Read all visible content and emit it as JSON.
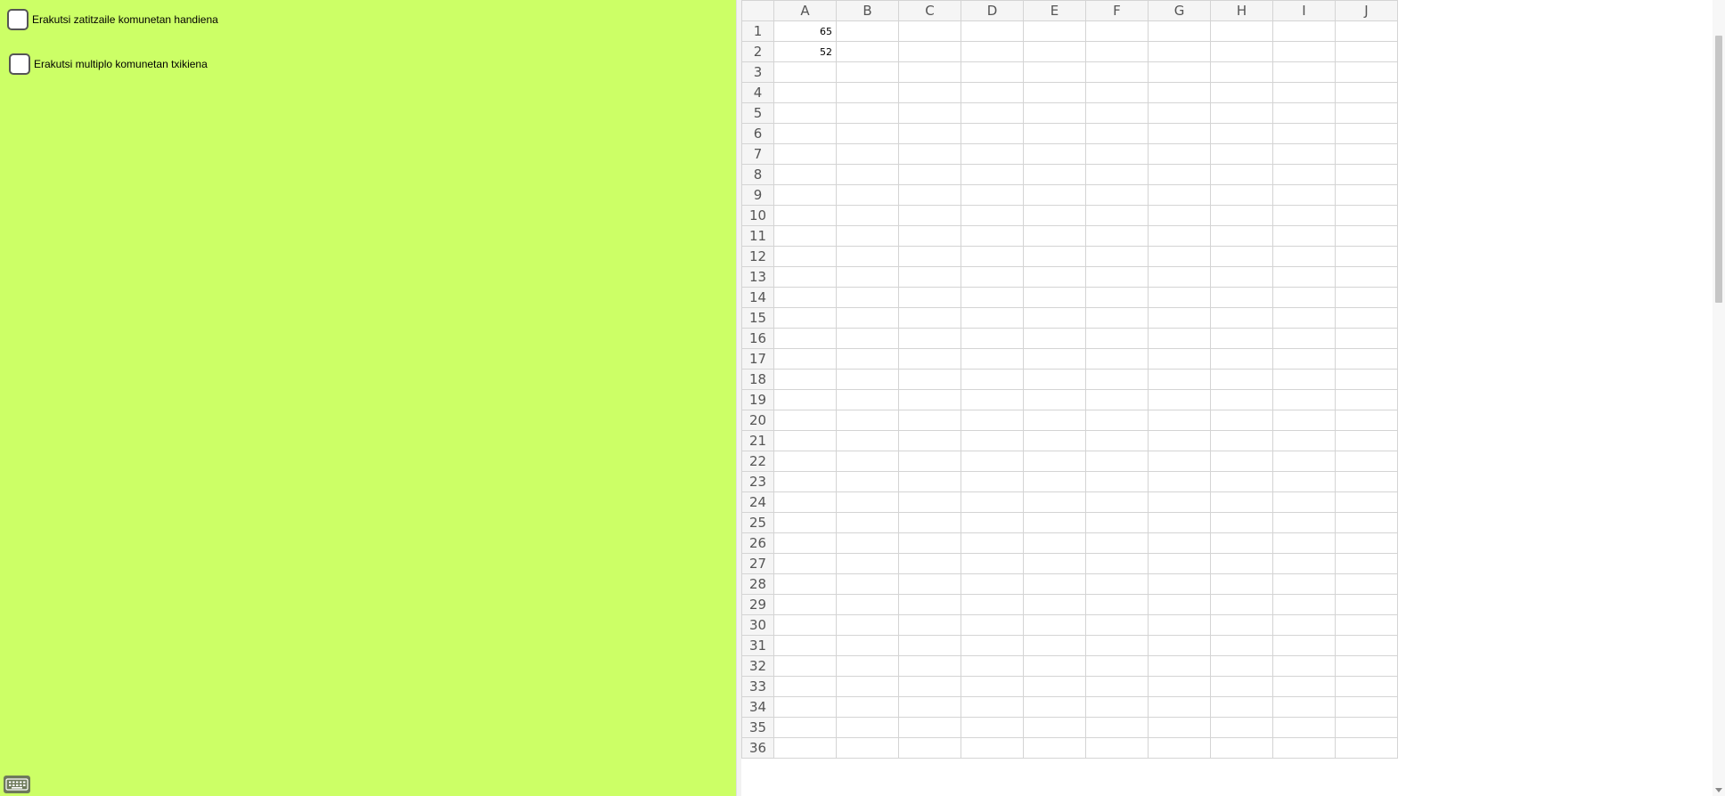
{
  "graphics": {
    "background_color": "#ccff66",
    "checkboxes": [
      {
        "label": "Erakutsi zatitzaile komunetan handiena",
        "checked": false
      },
      {
        "label": "Erakutsi multiplo komunetan txikiena",
        "checked": false
      }
    ],
    "keyboard_icon": "keyboard-icon"
  },
  "spreadsheet": {
    "columns": [
      "A",
      "B",
      "C",
      "D",
      "E",
      "F",
      "G",
      "H",
      "I",
      "J"
    ],
    "rows": [
      "1",
      "2",
      "3",
      "4",
      "5",
      "6",
      "7",
      "8",
      "9",
      "10",
      "11",
      "12",
      "13",
      "14",
      "15",
      "16",
      "17",
      "18",
      "19",
      "20",
      "21",
      "22",
      "23",
      "24",
      "25",
      "26",
      "27",
      "28",
      "29",
      "30",
      "31",
      "32",
      "33",
      "34",
      "35",
      "36"
    ],
    "cells": {
      "A1": "65",
      "A2": "52"
    }
  }
}
